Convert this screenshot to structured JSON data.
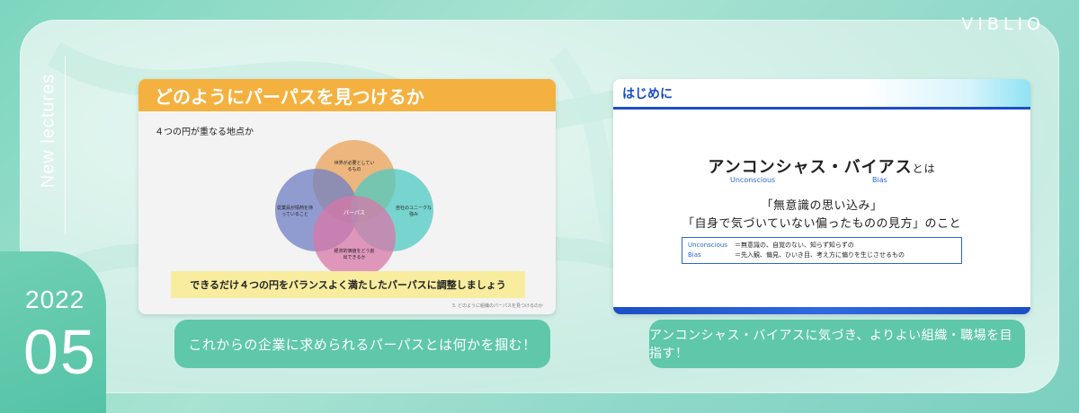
{
  "brand": "VIBLIO",
  "section_label": "New lectures",
  "issue": {
    "year": "2022",
    "number": "05"
  },
  "cards": [
    {
      "slide": {
        "heading": "どのようにパーパスを見つけるか",
        "subtitle": "４つの円が重なる地点か",
        "venn": {
          "top": "世界が必要としているもの",
          "left": "従業員が情熱を持っていること",
          "right": "自社のユニークな強み",
          "bottom": "経済的価値をどう創出できるか",
          "center": "パーパス",
          "colors": [
            "#e9a257",
            "#6f7fc4",
            "#4fc9c2",
            "#d877a8"
          ]
        },
        "band": "できるだけ４つの円をバランスよく満たしたパーパスに調整しましょう",
        "footer": "3. どのように組織のパーパスを見つけるのか"
      },
      "caption": "これからの企業に求められるパーパスとは何かを掴む！"
    },
    {
      "slide": {
        "heading": "はじめに",
        "title_main": "アンコンシャス・バイアス",
        "title_suffix": "とは",
        "en_1": "Unconscious",
        "en_2": "Bias",
        "quote_1": "「無意識の思い込み」",
        "quote_2": "「自身で気づいていない偏ったものの見方」のこと",
        "def_1_key": "Unconscious",
        "def_1_val": "＝無意識の、自覚のない、知らず知らずの",
        "def_2_key": "Bias",
        "def_2_val": "＝先入観、偏見、ひいき目、考え方に偏りを生じさせるもの"
      },
      "caption": "アンコンシャス・バイアスに気づき、よりよい組織・職場を目指す！"
    }
  ]
}
